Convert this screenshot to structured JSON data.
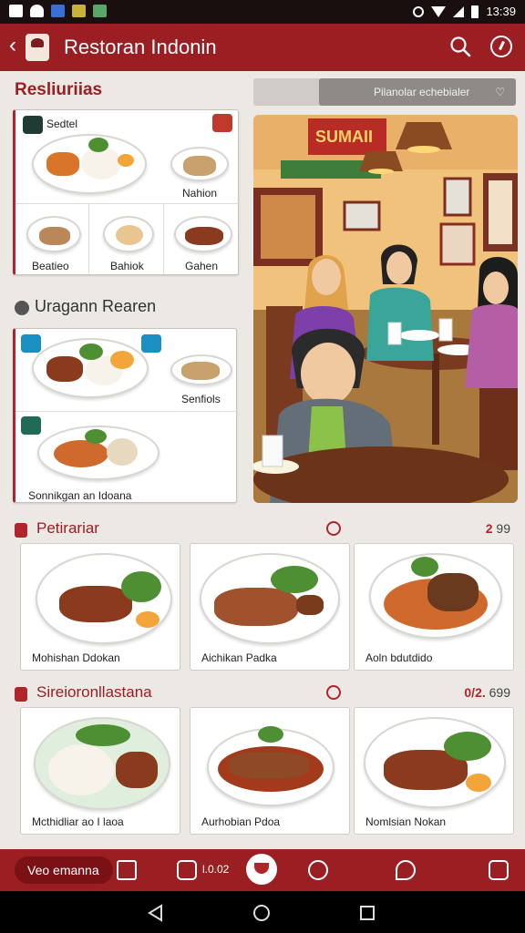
{
  "status": {
    "time": "13:39"
  },
  "app": {
    "title": "Restoran Indonin"
  },
  "filter": {
    "label": "Pilanolar echebialer"
  },
  "section1": {
    "title": "Resliuriias",
    "card_label": "Sedtel",
    "items": [
      "Nahion",
      "Beatieo",
      "Bahiok",
      "Gahen"
    ]
  },
  "section2": {
    "title": "Uragann Rearen",
    "items": [
      "Senfiols",
      "Sonnikgan an Idoana"
    ]
  },
  "scene": {
    "sign": "SUMAII"
  },
  "section3": {
    "title": "Petirariar",
    "count_prefix": "2",
    "count_value": "99",
    "dishes": [
      "Mohishan Ddokan",
      "Aichikan Padka",
      "Aoln bdutdido"
    ]
  },
  "section4": {
    "title": "Sireioronllastana",
    "count_prefix": "0/2.",
    "count_value": "699",
    "dishes": [
      "Mcthidliar ao I laoa",
      "Aurhobian Pdoa",
      "Nomlsian Nokan"
    ]
  },
  "bottom": {
    "pill_label": "Veo emanna",
    "mid_text": "l.0.02"
  },
  "colors": {
    "primary": "#9b1e23",
    "accent": "#b0252b",
    "background": "#ece8e4"
  }
}
